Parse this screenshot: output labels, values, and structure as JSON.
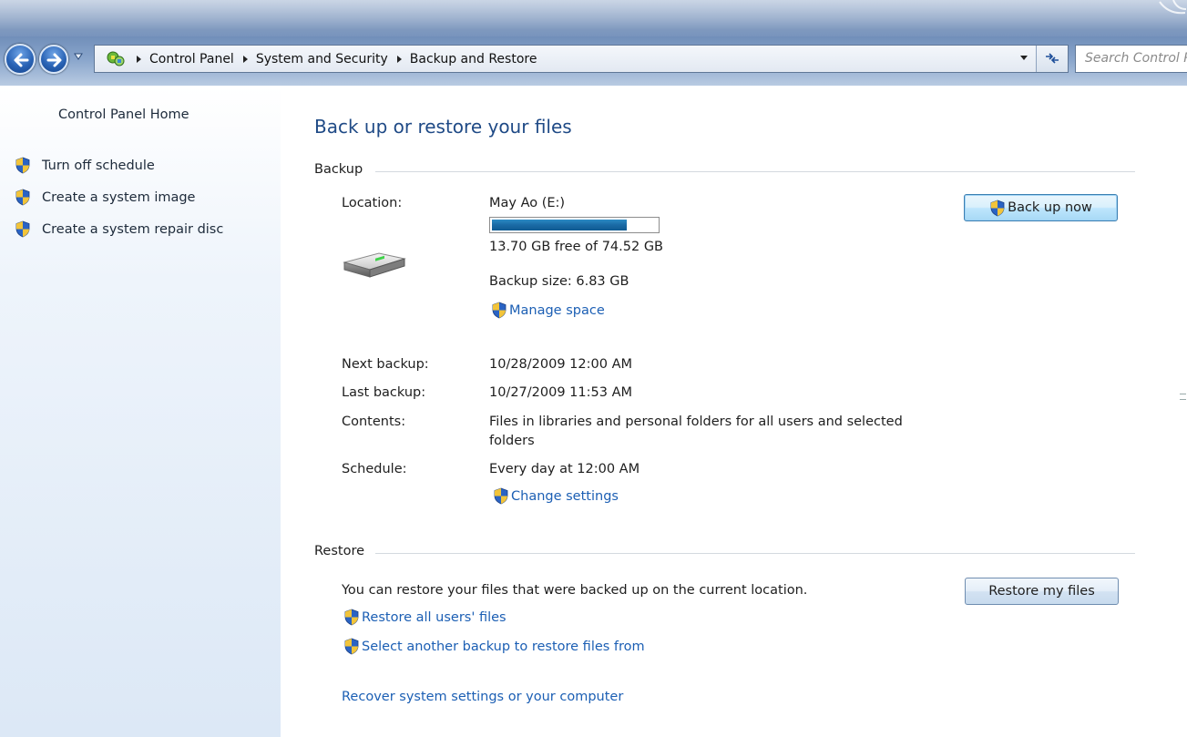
{
  "window": {
    "search_placeholder": "Search Control Panel"
  },
  "breadcrumb": [
    "Control Panel",
    "System and Security",
    "Backup and Restore"
  ],
  "sidebar": {
    "home_label": "Control Panel Home",
    "tasks": [
      {
        "label": "Turn off schedule",
        "icon": "uac-shield-icon"
      },
      {
        "label": "Create a system image",
        "icon": "uac-shield-icon"
      },
      {
        "label": "Create a system repair disc",
        "icon": "uac-shield-icon"
      }
    ]
  },
  "main": {
    "title": "Back up or restore your files",
    "backup": {
      "header": "Backup",
      "location_label": "Location:",
      "location_value": "May Ao (E:)",
      "disk_used_fraction": 0.816,
      "free_text": "13.70 GB free of 74.52 GB",
      "backup_size_text": "Backup size: 6.83 GB",
      "manage_space_link": "Manage space",
      "next_backup_label": "Next backup:",
      "next_backup_value": "10/28/2009 12:00 AM",
      "last_backup_label": "Last backup:",
      "last_backup_value": "10/27/2009 11:53 AM",
      "contents_label": "Contents:",
      "contents_line1": "Files in libraries and personal folders for all users and selected",
      "contents_line2": "folders",
      "schedule_label": "Schedule:",
      "schedule_value": "Every day at 12:00 AM",
      "change_settings_link": "Change settings",
      "back_up_now_button": "Back up now"
    },
    "restore": {
      "header": "Restore",
      "description": "You can restore your files that were backed up on the current location.",
      "restore_all_link": "Restore all users' files",
      "select_backup_link": "Select another backup to restore files from",
      "recover_link": "Recover system settings or your computer",
      "restore_button": "Restore my files"
    }
  },
  "colors": {
    "link": "#1c5fb4",
    "title": "#1f4a86",
    "progress_fill": "#1a6aa5"
  }
}
